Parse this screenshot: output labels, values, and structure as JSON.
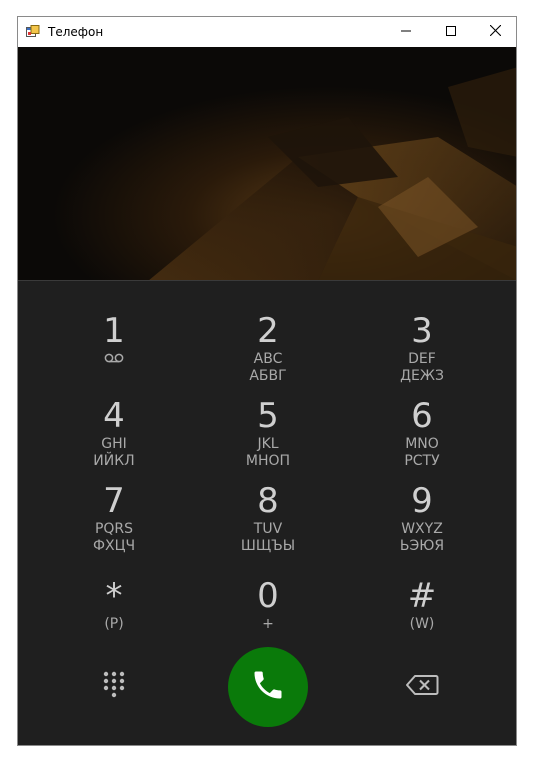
{
  "window": {
    "title": "Телефон"
  },
  "icons": {
    "app": "app-window-icon",
    "minimize": "minimize-icon",
    "maximize": "maximize-icon",
    "close": "close-icon",
    "voicemail": "voicemail-icon",
    "dialpad": "dialpad-icon",
    "call": "phone-call-icon",
    "backspace": "backspace-icon"
  },
  "colors": {
    "call_button": "#0a7a0a",
    "keypad_background": "#1f1f1f",
    "digit_text": "#cfcfcf",
    "sub_text": "#a9a9a9"
  },
  "keypad": {
    "keys": [
      {
        "digit": "1",
        "line1": "",
        "line2": ""
      },
      {
        "digit": "2",
        "line1": "ABC",
        "line2": "АБВГ"
      },
      {
        "digit": "3",
        "line1": "DEF",
        "line2": "ДЕЖЗ"
      },
      {
        "digit": "4",
        "line1": "GHI",
        "line2": "ИЙКЛ"
      },
      {
        "digit": "5",
        "line1": "JKL",
        "line2": "МНОП"
      },
      {
        "digit": "6",
        "line1": "MNO",
        "line2": "РСТУ"
      },
      {
        "digit": "7",
        "line1": "PQRS",
        "line2": "ФХЦЧ"
      },
      {
        "digit": "8",
        "line1": "TUV",
        "line2": "ШЩЪЫ"
      },
      {
        "digit": "9",
        "line1": "WXYZ",
        "line2": "ЬЭЮЯ"
      },
      {
        "digit": "*",
        "line1": "(P)",
        "line2": ""
      },
      {
        "digit": "0",
        "line1": "+",
        "line2": ""
      },
      {
        "digit": "#",
        "line1": "(W)",
        "line2": ""
      }
    ]
  }
}
